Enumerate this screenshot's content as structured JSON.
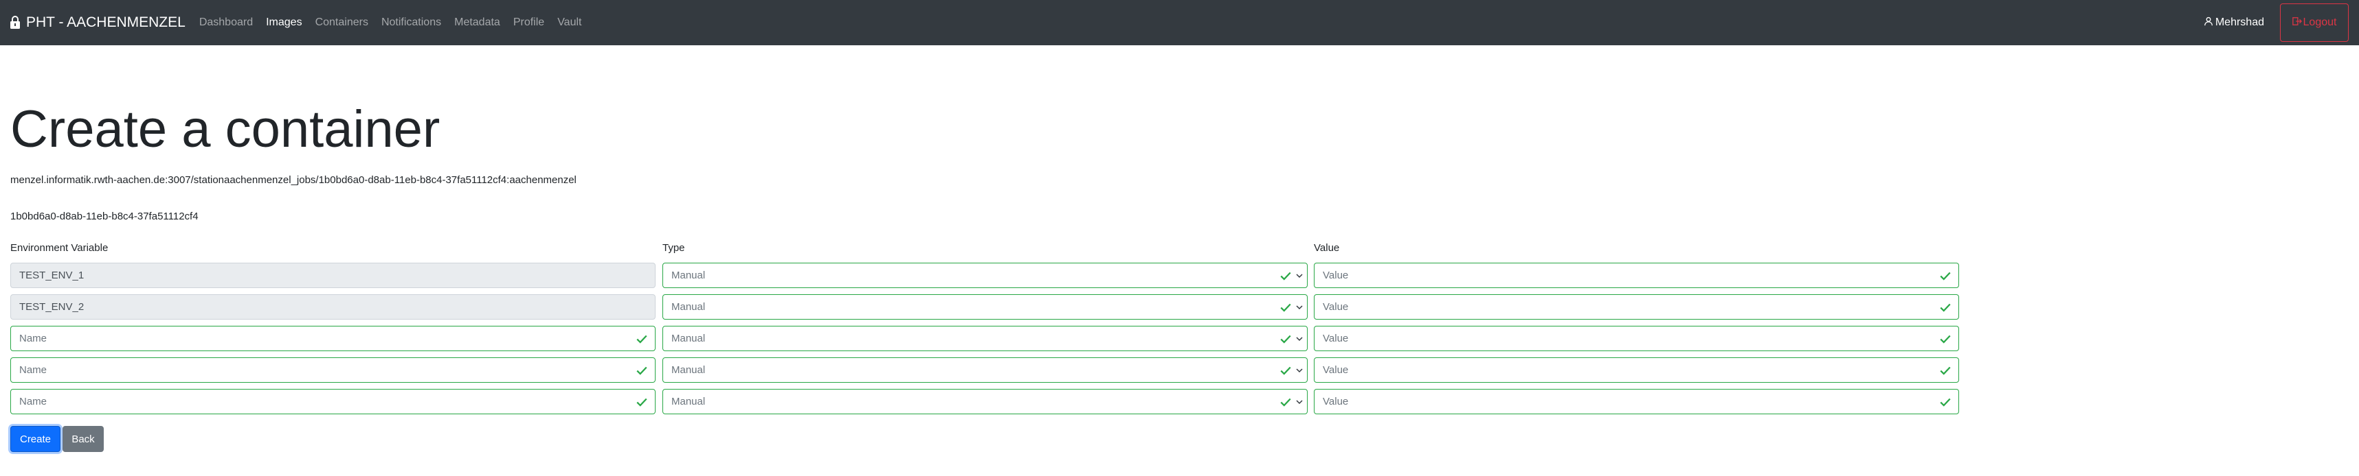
{
  "navbar": {
    "brand": "PHT - AACHENMENZEL",
    "links": [
      {
        "label": "Dashboard",
        "active": false
      },
      {
        "label": "Images",
        "active": true
      },
      {
        "label": "Containers",
        "active": false
      },
      {
        "label": "Notifications",
        "active": false
      },
      {
        "label": "Metadata",
        "active": false
      },
      {
        "label": "Profile",
        "active": false
      },
      {
        "label": "Vault",
        "active": false
      }
    ],
    "user": "Mehrshad",
    "logout": "Logout"
  },
  "page": {
    "title": "Create a container",
    "image_path": "menzel.informatik.rwth-aachen.de:3007/stationaachenmenzel_jobs/1b0bd6a0-d8ab-11eb-b8c4-37fa51112cf4:aachenmenzel",
    "job_id": "1b0bd6a0-d8ab-11eb-b8c4-37fa51112cf4"
  },
  "form": {
    "columns": {
      "name": "Environment Variable",
      "type": "Type",
      "value": "Value"
    },
    "rows": [
      {
        "name": "TEST_ENV_1",
        "name_readonly": true,
        "type": "Manual",
        "value_placeholder": "Value"
      },
      {
        "name": "TEST_ENV_2",
        "name_readonly": true,
        "type": "Manual",
        "value_placeholder": "Value"
      },
      {
        "name": "Name",
        "name_readonly": false,
        "type": "Manual",
        "value_placeholder": "Value"
      },
      {
        "name": "Name",
        "name_readonly": false,
        "type": "Manual",
        "value_placeholder": "Value"
      },
      {
        "name": "Name",
        "name_readonly": false,
        "type": "Manual",
        "value_placeholder": "Value"
      }
    ],
    "create_label": "Create",
    "back_label": "Back"
  },
  "colors": {
    "navbar_bg": "#343a40",
    "valid_green": "#28a745",
    "danger_red": "#dc3545",
    "primary_blue": "#0d6efd",
    "secondary_gray": "#6c757d"
  }
}
